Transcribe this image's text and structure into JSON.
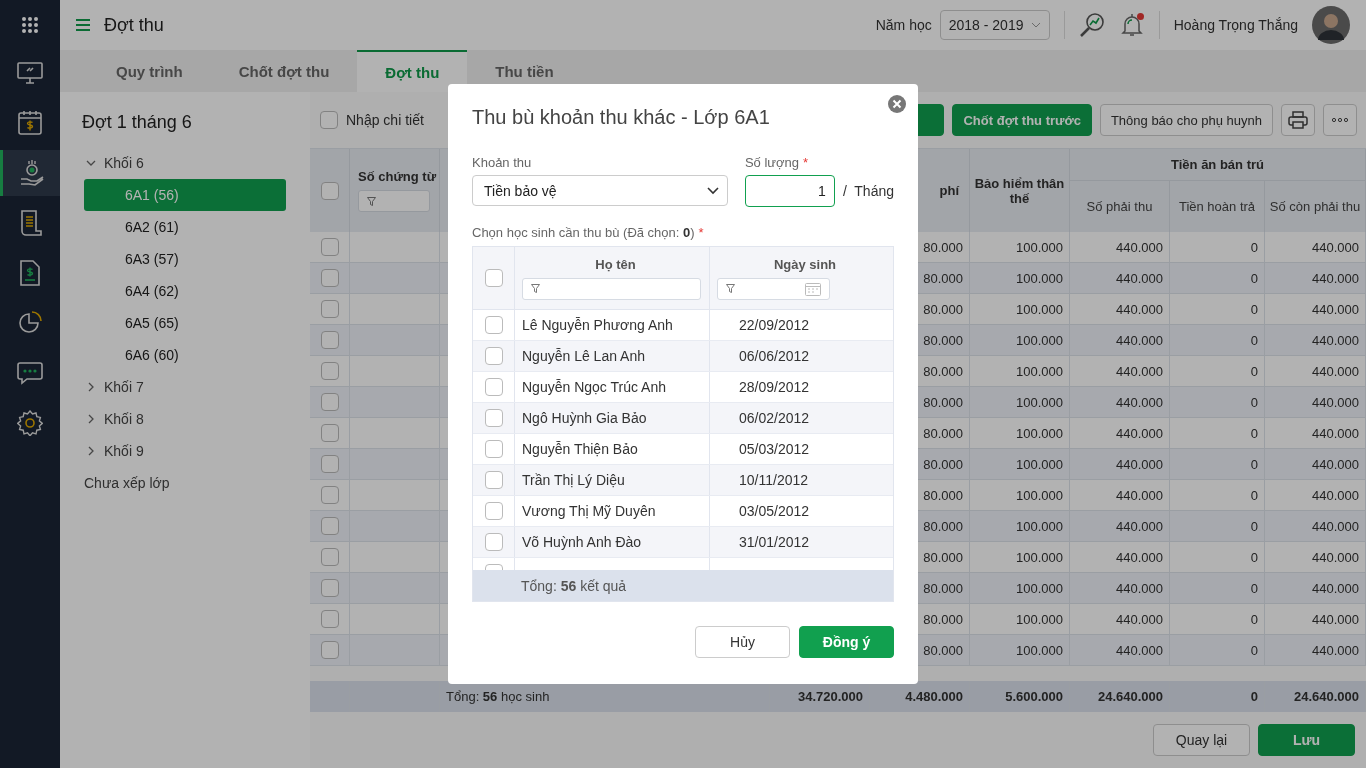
{
  "nav": [
    {
      "kind": "dashboard",
      "selected": false
    },
    {
      "kind": "calendar",
      "selected": false
    },
    {
      "kind": "collect",
      "selected": true
    },
    {
      "kind": "scroll",
      "selected": false
    },
    {
      "kind": "invoice",
      "selected": false
    },
    {
      "kind": "chart",
      "selected": false
    },
    {
      "kind": "chat",
      "selected": false
    },
    {
      "kind": "settings",
      "selected": false
    }
  ],
  "header": {
    "title": "Đợt thu",
    "school_year_label": "Năm học",
    "school_year": "2018 - 2019",
    "has_notification": true,
    "user_name": "Hoàng Trọng  Thắng"
  },
  "tabs": [
    {
      "label": "Quy trình",
      "selected": false
    },
    {
      "label": "Chốt đợt thu",
      "selected": false
    },
    {
      "label": "Đợt thu",
      "selected": true
    },
    {
      "label": "Thu tiền",
      "selected": false
    }
  ],
  "sidebar": {
    "title": "Đợt 1 tháng 6",
    "tree": [
      {
        "label": "Khối 6",
        "expanded": true,
        "children": [
          {
            "label": "6A1 (56)",
            "selected": true
          },
          {
            "label": "6A2 (61)",
            "selected": false
          },
          {
            "label": "6A3 (57)",
            "selected": false
          },
          {
            "label": "6A4 (62)",
            "selected": false
          },
          {
            "label": "6A5 (65)",
            "selected": false
          },
          {
            "label": "6A6 (60)",
            "selected": false
          }
        ]
      },
      {
        "label": "Khối 7",
        "expanded": false
      },
      {
        "label": "Khối 8",
        "expanded": false
      },
      {
        "label": "Khối 9",
        "expanded": false
      },
      {
        "label": "Chưa xếp lớp"
      }
    ]
  },
  "toolbar": {
    "detail_checkbox": {
      "label": "Nhập chi tiết",
      "checked": false
    },
    "buttons": [
      {
        "kind": "primary"
      },
      {
        "kind": "primary",
        "label": "Chốt đợt thu trước"
      },
      {
        "kind": "secondary",
        "label": "Thông báo cho phụ huynh"
      },
      {
        "kind": "print"
      },
      {
        "kind": "more"
      }
    ]
  },
  "table": {
    "all_checked": false,
    "header": {
      "voucher": "Số chứng từ",
      "column_5": "phí",
      "insurance": "Bảo hiểm thân thế",
      "meal_group": "Tiền ăn bán trú",
      "due": "Số phải thu",
      "refund": "Tiền hoàn trả",
      "remaining": "Số còn phải thu"
    },
    "rows": [
      {
        "checked": false,
        "column_5": "80.000",
        "insurance": "100.000",
        "due": "440.000",
        "refund": "0",
        "remaining": "440.000"
      },
      {
        "checked": false,
        "column_5": "80.000",
        "insurance": "100.000",
        "due": "440.000",
        "refund": "0",
        "remaining": "440.000"
      },
      {
        "checked": false,
        "column_5": "80.000",
        "insurance": "100.000",
        "due": "440.000",
        "refund": "0",
        "remaining": "440.000"
      },
      {
        "checked": false,
        "column_5": "80.000",
        "insurance": "100.000",
        "due": "440.000",
        "refund": "0",
        "remaining": "440.000"
      },
      {
        "checked": false,
        "column_5": "80.000",
        "insurance": "100.000",
        "due": "440.000",
        "refund": "0",
        "remaining": "440.000"
      },
      {
        "checked": false,
        "column_5": "80.000",
        "insurance": "100.000",
        "due": "440.000",
        "refund": "0",
        "remaining": "440.000"
      },
      {
        "checked": false,
        "column_5": "80.000",
        "insurance": "100.000",
        "due": "440.000",
        "refund": "0",
        "remaining": "440.000"
      },
      {
        "checked": false,
        "column_5": "80.000",
        "insurance": "100.000",
        "due": "440.000",
        "refund": "0",
        "remaining": "440.000"
      },
      {
        "checked": false,
        "column_5": "80.000",
        "insurance": "100.000",
        "due": "440.000",
        "refund": "0",
        "remaining": "440.000"
      },
      {
        "checked": false,
        "column_5": "80.000",
        "insurance": "100.000",
        "due": "440.000",
        "refund": "0",
        "remaining": "440.000"
      },
      {
        "checked": false,
        "column_5": "80.000",
        "insurance": "100.000",
        "due": "440.000",
        "refund": "0",
        "remaining": "440.000"
      },
      {
        "checked": false,
        "column_5": "80.000",
        "insurance": "100.000",
        "due": "440.000",
        "refund": "0",
        "remaining": "440.000"
      },
      {
        "checked": false,
        "column_5": "80.000",
        "insurance": "100.000",
        "due": "440.000",
        "refund": "0",
        "remaining": "440.000"
      },
      {
        "checked": false,
        "column_5": "80.000",
        "insurance": "100.000",
        "due": "440.000",
        "refund": "0",
        "remaining": "440.000"
      }
    ],
    "totals": {
      "label": "Tổng: **56** học sinh",
      "column_4": "34.720.000",
      "column_5": "4.480.000",
      "insurance": "5.600.000",
      "due": "24.640.000",
      "refund": "0",
      "remaining": "24.640.000"
    }
  },
  "footer_buttons": [
    {
      "kind": "secondary",
      "label": "Quay lại"
    },
    {
      "kind": "primary",
      "label": "Lưu"
    }
  ],
  "modal": {
    "title": "Thu bù khoản thu khác - Lớp 6A1",
    "fee_field": {
      "label": "Khoản thu",
      "value": "Tiền bảo vệ"
    },
    "quantity_field": {
      "label": "Số lượng",
      "required_mark": "*",
      "value": "1",
      "unit": "/  Tháng"
    },
    "students_label": "Chọn học sinh cần thu bù (Đã chọn: **0**)",
    "students_required_mark": "*",
    "students_table": {
      "columns": [
        "Họ tên",
        "Ngày sinh"
      ],
      "all_checked": false,
      "rows": [
        {
          "name": "Lê Nguyễn Phương Anh",
          "dob": "22/09/2012",
          "checked": false
        },
        {
          "name": "Nguyễn Lê  Lan Anh",
          "dob": "06/06/2012",
          "checked": false
        },
        {
          "name": "Nguyễn Ngọc Trúc Anh",
          "dob": "28/09/2012",
          "checked": false
        },
        {
          "name": "Ngô Huỳnh Gia Bảo",
          "dob": "06/02/2012",
          "checked": false
        },
        {
          "name": "Nguyễn Thiện Bảo",
          "dob": "05/03/2012",
          "checked": false
        },
        {
          "name": "Trần Thị Lý Diệu",
          "dob": "10/11/2012",
          "checked": false
        },
        {
          "name": "Vương Thị Mỹ Duyên",
          "dob": "03/05/2012",
          "checked": false
        },
        {
          "name": "Võ Huỳnh Anh Đào",
          "dob": "31/01/2012",
          "checked": false
        }
      ],
      "footer": "Tổng: **56** kết quả"
    },
    "buttons": [
      {
        "kind": "secondary",
        "label": "Hủy"
      },
      {
        "kind": "primary",
        "label": "Đồng ý"
      }
    ]
  }
}
